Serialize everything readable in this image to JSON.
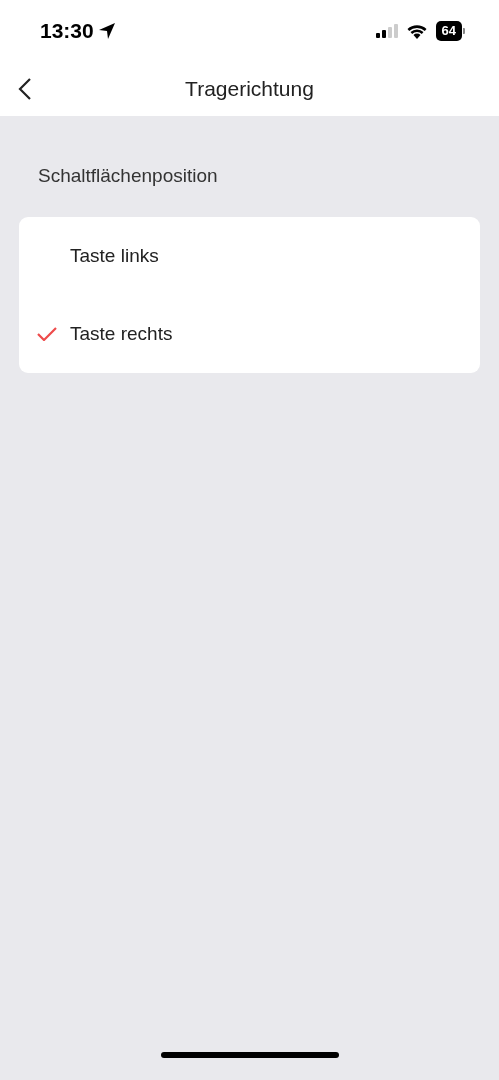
{
  "status_bar": {
    "time": "13:30",
    "battery": "64"
  },
  "nav": {
    "title": "Tragerichtung"
  },
  "section": {
    "label": "Schaltflächenposition",
    "options": [
      {
        "label": "Taste links",
        "selected": false
      },
      {
        "label": "Taste rechts",
        "selected": true
      }
    ]
  }
}
